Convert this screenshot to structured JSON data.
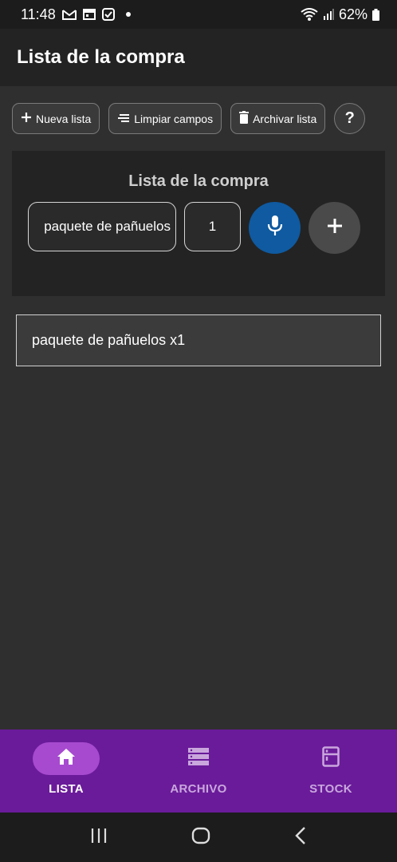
{
  "status_bar": {
    "time": "11:48",
    "battery": "62%",
    "icons": [
      "gmail-icon",
      "calendar-icon",
      "checkbox-icon",
      "dot-icon",
      "wifi-icon",
      "signal-icon",
      "battery-icon"
    ]
  },
  "app_bar": {
    "title": "Lista de la compra"
  },
  "toolbar": {
    "new_list": "Nueva lista",
    "clear_fields": "Limpiar campos",
    "archive_list": "Archivar lista",
    "help": "?"
  },
  "form": {
    "title": "Lista de la compra",
    "item_value": "paquete de pañuelos",
    "quantity_value": "1"
  },
  "list": {
    "items": [
      {
        "label": "paquete de pañuelos x1"
      }
    ]
  },
  "bottom_nav": {
    "items": [
      {
        "label": "LISTA",
        "icon": "home-icon",
        "active": true
      },
      {
        "label": "ARCHIVO",
        "icon": "archive-icon",
        "active": false
      },
      {
        "label": "STOCK",
        "icon": "fridge-icon",
        "active": false
      }
    ]
  },
  "colors": {
    "background": "#2f2f2f",
    "accent_nav": "#6a1b9a",
    "active_pill": "#a74ad0",
    "mic_button": "#0f5aa0"
  }
}
